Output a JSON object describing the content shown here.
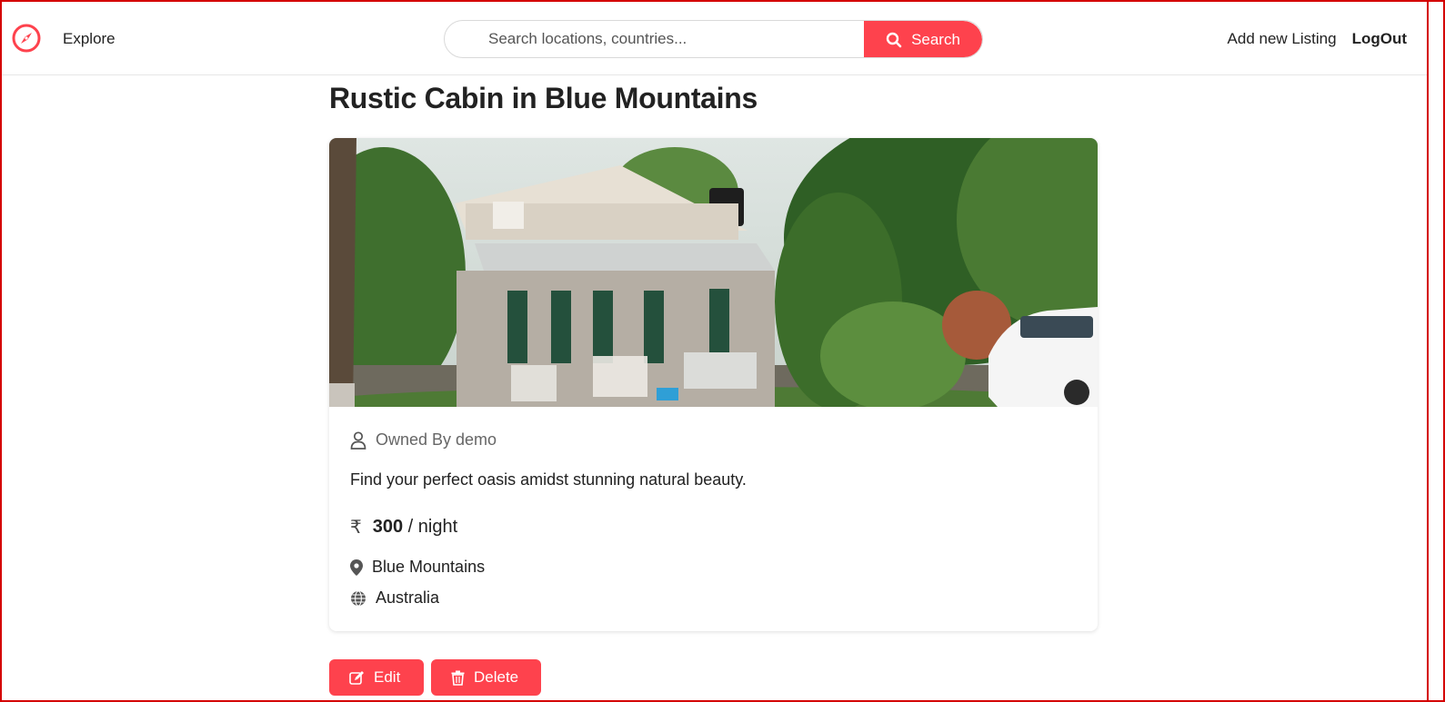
{
  "navbar": {
    "explore_label": "Explore",
    "search": {
      "placeholder": "Search locations, countries...",
      "button_label": "Search"
    },
    "add_listing_label": "Add new Listing",
    "logout_label": "LogOut"
  },
  "listing": {
    "title": "Rustic Cabin in Blue Mountains",
    "owner": "Owned By demo",
    "description": "Find your perfect oasis amidst stunning natural beauty.",
    "currency_symbol": "₹",
    "price": "300",
    "price_unit": "/ night",
    "location": "Blue Mountains",
    "country": "Australia"
  },
  "actions": {
    "edit_label": "Edit",
    "delete_label": "Delete"
  },
  "colors": {
    "accent": "#fe424d",
    "text": "#222222",
    "muted": "#666666"
  }
}
